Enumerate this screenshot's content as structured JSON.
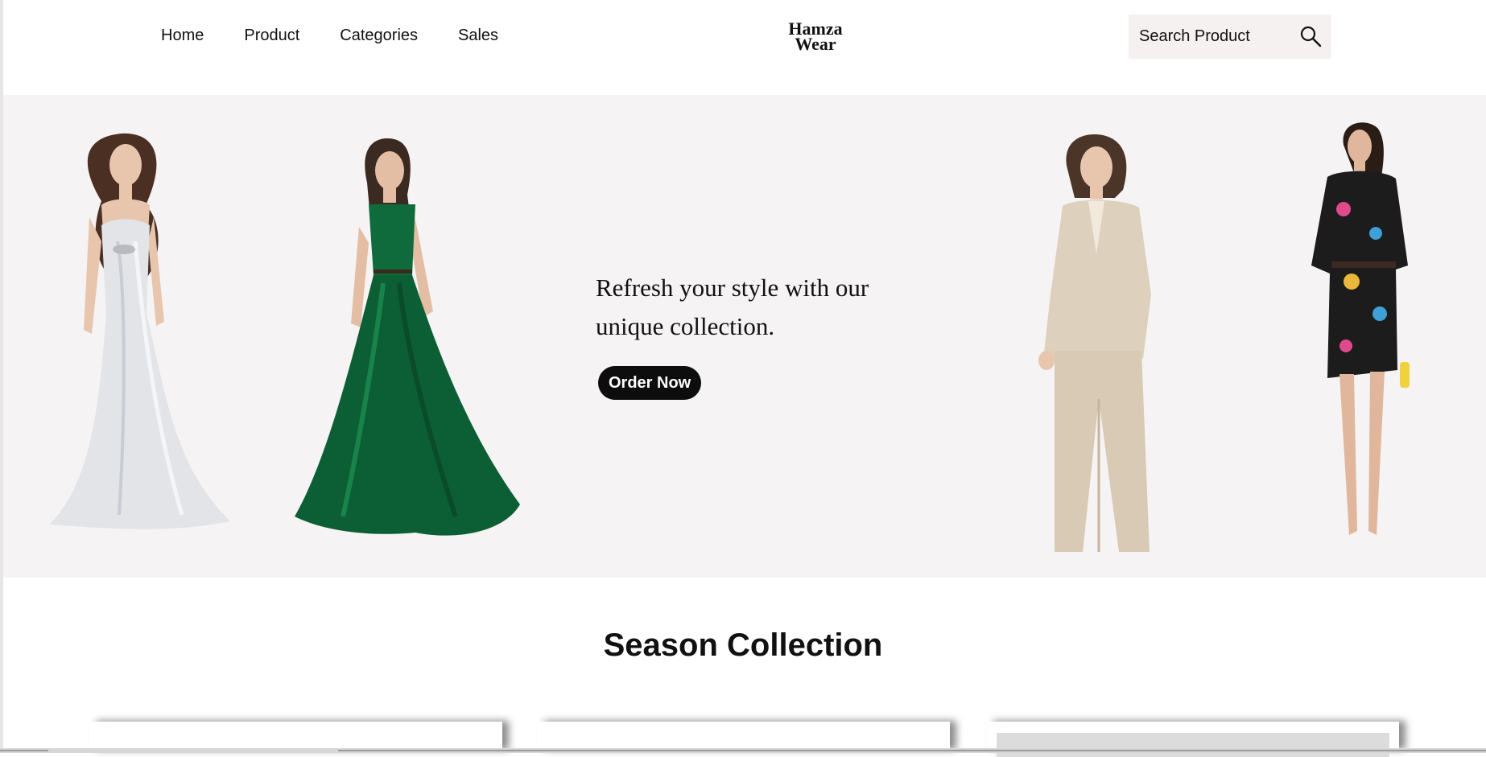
{
  "nav": {
    "items": [
      {
        "label": "Home"
      },
      {
        "label": "Product"
      },
      {
        "label": "Categories"
      },
      {
        "label": "Sales"
      }
    ]
  },
  "brand": {
    "line1": "Hamza",
    "line2": "Wear"
  },
  "search": {
    "placeholder": "Search Product",
    "icon": "search-icon"
  },
  "hero": {
    "line1": "Refresh your style with our",
    "line2": "unique collection.",
    "cta": "Order Now",
    "figures": [
      {
        "name": "model-white-gown",
        "colors": [
          "#e4e5e8",
          "#5a3a2a"
        ]
      },
      {
        "name": "model-green-gown",
        "colors": [
          "#0f6b3c",
          "#3b2a22"
        ]
      },
      {
        "name": "model-beige-suit",
        "colors": [
          "#ddd0bd",
          "#4a3528"
        ]
      },
      {
        "name": "model-printed-dress",
        "colors": [
          "#1c1c1c",
          "#e9b83b"
        ]
      }
    ]
  },
  "section": {
    "title": "Season Collection"
  },
  "colors": {
    "accent": "#0d0d0d",
    "hero_bg": "#f5f3f3",
    "search_bg": "#f4f1f0"
  }
}
